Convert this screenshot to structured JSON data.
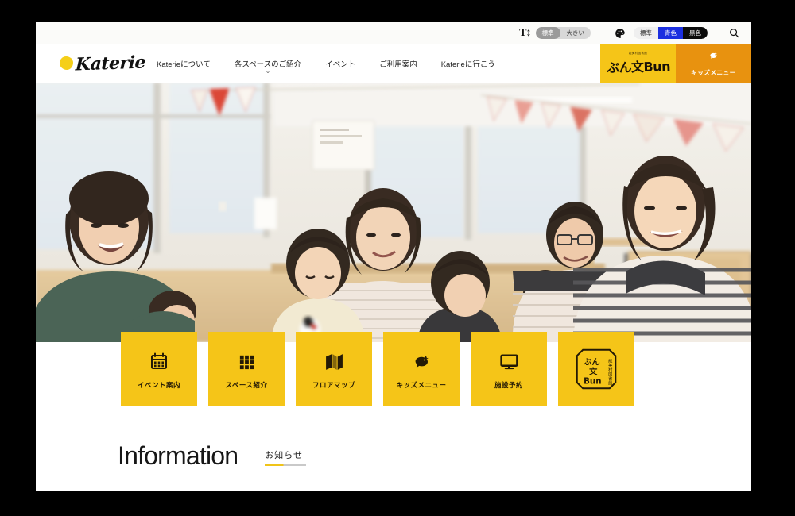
{
  "utility_bar": {
    "font_size": {
      "icon": "text-size-icon",
      "options": [
        {
          "label": "標準",
          "selected": true
        },
        {
          "label": "大きい",
          "selected": false
        }
      ]
    },
    "color_scheme": {
      "icon": "palette-icon",
      "options": [
        {
          "label": "標準",
          "selected": false,
          "color": "#efefef"
        },
        {
          "label": "青色",
          "selected": false,
          "color": "#1b2fe0"
        },
        {
          "label": "黒色",
          "selected": false,
          "color": "#0b0b0b"
        }
      ]
    },
    "search": {
      "icon": "search-icon",
      "label": "検索"
    }
  },
  "header": {
    "logo": {
      "text": "Katerie",
      "mark": "yellow-dot-icon"
    },
    "nav": [
      {
        "label": "Katerieについて",
        "has_dropdown": false
      },
      {
        "label": "各スペースのご紹介",
        "has_dropdown": true
      },
      {
        "label": "イベント",
        "has_dropdown": false
      },
      {
        "label": "ご利用案内",
        "has_dropdown": false
      },
      {
        "label": "Katerieに行こう",
        "has_dropdown": false
      }
    ],
    "cta_bun": {
      "small": "能美村図書館",
      "word": "ぶん文Bun",
      "bg": "#f5c518"
    },
    "cta_kids": {
      "label": "キッズメニュー",
      "icon": "bird-icon",
      "bg": "#e8920f"
    }
  },
  "hero": {
    "alt": "Parents and children in a bright wooden community room with bunting flags"
  },
  "tiles": [
    {
      "label": "イベント案内",
      "icon": "calendar-icon"
    },
    {
      "label": "スペース紹介",
      "icon": "grid-icon"
    },
    {
      "label": "フロアマップ",
      "icon": "map-icon"
    },
    {
      "label": "キッズメニュー",
      "icon": "bird-icon"
    },
    {
      "label": "施設予約",
      "icon": "monitor-icon"
    },
    {
      "label": "ぶん文Bun",
      "icon": "bun-stamp-icon",
      "stamp_side_text": "能美村図書館"
    }
  ],
  "information": {
    "title": "Information",
    "subtitle": "お知らせ"
  },
  "colors": {
    "brand_yellow": "#f5c518",
    "accent_orange": "#e8920f",
    "accent_blue": "#1b2fe0",
    "text_dark": "#161616",
    "page_bg": "#ffffff",
    "frame": "#000000"
  }
}
